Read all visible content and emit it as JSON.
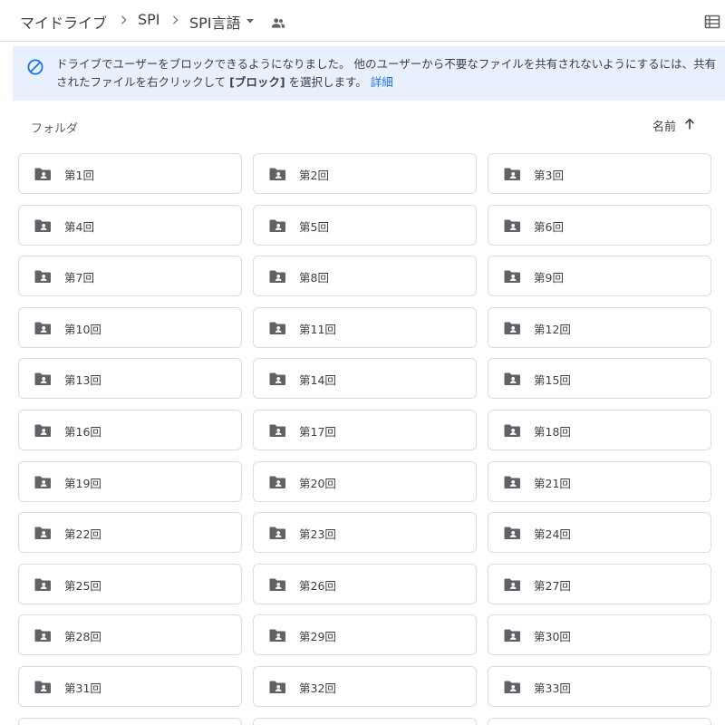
{
  "breadcrumb": {
    "items": [
      {
        "label": "マイドライブ"
      },
      {
        "label": "SPI"
      },
      {
        "label": "SPI言語"
      }
    ]
  },
  "icons": {
    "separator": "chevron-right-icon",
    "dropdown": "caret-down-icon",
    "shared": "people-icon",
    "view": "list-view-icon",
    "banner": "block-icon",
    "sort": "arrow-up-icon",
    "folder": "shared-folder-icon"
  },
  "colors": {
    "banner_background": "#e8f0fe",
    "link": "#1a73e8",
    "folder_icon": "#5f6368"
  },
  "banner": {
    "text_before": "ドライブでユーザーをブロックできるようになりました。 他のユーザーから不要なファイルを共有されないようにするには、共有されたファイルを右クリックして ",
    "bold": "[ブロック]",
    "text_after": " を選択します。 ",
    "link": "詳細"
  },
  "section": {
    "title": "フォルダ"
  },
  "sort": {
    "label": "名前",
    "direction": "ascending"
  },
  "folders": [
    {
      "name": "第1回"
    },
    {
      "name": "第2回"
    },
    {
      "name": "第3回"
    },
    {
      "name": "第4回"
    },
    {
      "name": "第5回"
    },
    {
      "name": "第6回"
    },
    {
      "name": "第7回"
    },
    {
      "name": "第8回"
    },
    {
      "name": "第9回"
    },
    {
      "name": "第10回"
    },
    {
      "name": "第11回"
    },
    {
      "name": "第12回"
    },
    {
      "name": "第13回"
    },
    {
      "name": "第14回"
    },
    {
      "name": "第15回"
    },
    {
      "name": "第16回"
    },
    {
      "name": "第17回"
    },
    {
      "name": "第18回"
    },
    {
      "name": "第19回"
    },
    {
      "name": "第20回"
    },
    {
      "name": "第21回"
    },
    {
      "name": "第22回"
    },
    {
      "name": "第23回"
    },
    {
      "name": "第24回"
    },
    {
      "name": "第25回"
    },
    {
      "name": "第26回"
    },
    {
      "name": "第27回"
    },
    {
      "name": "第28回"
    },
    {
      "name": "第29回"
    },
    {
      "name": "第30回"
    },
    {
      "name": "第31回"
    },
    {
      "name": "第32回"
    },
    {
      "name": "第33回"
    },
    {
      "name": ""
    },
    {
      "name": ""
    },
    {
      "name": ""
    }
  ]
}
